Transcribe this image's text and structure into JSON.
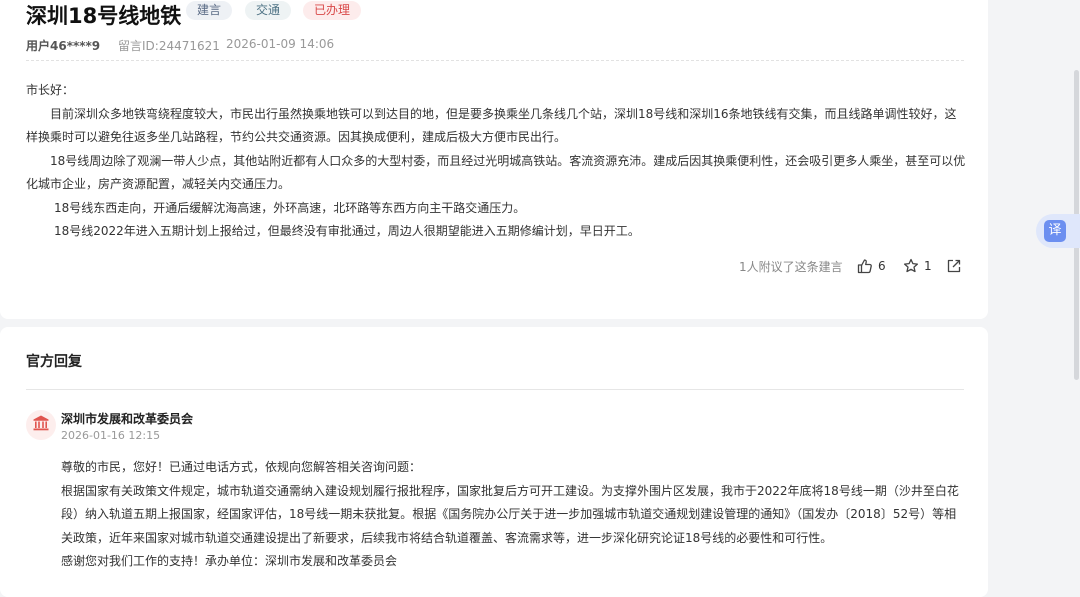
{
  "post": {
    "title": "深圳18号线地铁",
    "tags": [
      "建言",
      "交通",
      "已办理"
    ],
    "user": "用户46****9",
    "message_id": "留言ID:24471621",
    "time": "2026-01-09 14:06",
    "paragraphs": [
      "市长好：",
      "目前深圳众多地铁弯绕程度较大，市民出行虽然换乘地铁可以到达目的地，但是要多换乘坐几条线几个站，深圳18号线和深圳16条地铁线有交集，而且线路单调性较好，这样换乘时可以避免往返多坐几站路程，节约公共交通资源。因其换成便利，建成后极大方便市民出行。",
      " 18号线周边除了观澜一带人少点，其他站附近都有人口众多的大型村委，而且经过光明城高铁站。客流资源充沛。建成后因其换乘便利性，还会吸引更多人乘坐，甚至可以优化城市企业，房产资源配置，减轻关内交通压力。",
      "18号线东西走向，开通后缓解沈海高速，外环高速，北环路等东西方向主干路交通压力。",
      "18号线2022年进入五期计划上报给过，但最终没有审批通过，周边人很期望能进入五期修编计划，早日开工。"
    ],
    "endorse_text": "1人附议了这条建言",
    "like_count": "6",
    "star_count": "1"
  },
  "reply": {
    "section_title": "官方回复",
    "org_name": "深圳市发展和改革委员会",
    "time": "2026-01-16 12:15",
    "paragraphs": [
      "尊敬的市民，您好！已通过电话方式，依规向您解答相关咨询问题：",
      "根据国家有关政策文件规定，城市轨道交通需纳入建设规划履行报批程序，国家批复后方可开工建设。为支撑外围片区发展，我市于2022年底将18号线一期（沙井至白花段）纳入轨道五期上报国家，经国家评估，18号线一期未获批复。根据《国务院办公厅关于进一步加强城市轨道交通规划建设管理的通知》（国发办〔2018〕52号）等相关政策，近年来国家对城市轨道交通建设提出了新要求，后续我市将结合轨道覆盖、客流需求等，进一步深化研究论证18号线的必要性和可行性。",
      "感谢您对我们工作的支持！承办单位：深圳市发展和改革委员会"
    ]
  },
  "translate_label": "译",
  "icons": {
    "like": "thumbs-up-icon",
    "star": "star-icon",
    "share": "share-icon",
    "org": "government-building-icon"
  }
}
